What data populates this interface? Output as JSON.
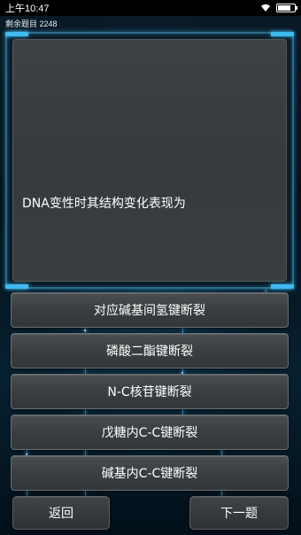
{
  "status_bar": {
    "time": "上午10:47",
    "wifi_icon": "wifi-icon",
    "battery_icon": "battery-icon"
  },
  "remaining": {
    "label": "剩余题目 2248"
  },
  "question": {
    "text": "DNA变性时其结构变化表现为"
  },
  "options": [
    "对应碱基间氢键断裂",
    "磷酸二酯键断裂",
    "N-C核苷键断裂",
    "戊糖内C-C键断裂",
    "碱基内C-C键断裂"
  ],
  "nav": {
    "back_label": "返回",
    "next_label": "下一题"
  },
  "colors": {
    "accent": "#3fb9ee",
    "panel": "#3a3e40"
  }
}
